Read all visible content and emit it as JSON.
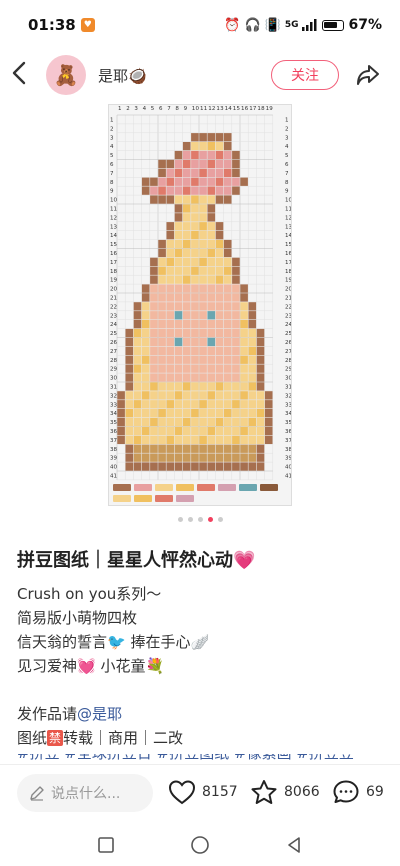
{
  "status_bar": {
    "time": "01:38",
    "signal_label": "5G",
    "battery_pct": "67%"
  },
  "header": {
    "username": "是耶🥥",
    "follow_label": "关注"
  },
  "pattern": {
    "columns": [
      "1",
      "2",
      "3",
      "4",
      "5",
      "6",
      "7",
      "8",
      "9",
      "10",
      "11",
      "12",
      "13",
      "14",
      "15",
      "16",
      "17",
      "18",
      "19"
    ],
    "rows": [
      "1",
      "2",
      "3",
      "4",
      "5",
      "6",
      "7",
      "8",
      "9",
      "10",
      "11",
      "12",
      "13",
      "14",
      "15",
      "16",
      "17",
      "18",
      "19",
      "20",
      "21",
      "22",
      "23",
      "24",
      "25",
      "26",
      "27",
      "28",
      "29",
      "30",
      "31",
      "32",
      "33",
      "34",
      "35",
      "36",
      "37",
      "38",
      "39",
      "40",
      "41"
    ],
    "palette": [
      "#a66f4f",
      "#e8a0a0",
      "#f5d28a",
      "#f0c060",
      "#e07a6a",
      "#d4a0b0",
      "#6aa6b0",
      "#8a5a3a",
      "#f2b8a0",
      "#c99a5a"
    ]
  },
  "carousel": {
    "count": 5,
    "active": 3
  },
  "post": {
    "title": "拼豆图纸｜星星人怦然心动💗",
    "line1": "Crush on you系列～",
    "line2": "简易版小萌物四枚",
    "line3": "信天翁的誓言🐦‍  捧在手心🪽",
    "line4": "见习爱神💓       小花童💐",
    "line5_prefix": "发作品请",
    "line5_link": "@是耶",
    "line6_a": "图纸",
    "line6_forbid": "禁",
    "line6_b": "转载｜商用｜二改",
    "tags": "#拼豆  #全球拼豆日  #拼豆图纸  #像素画  #拼豆豆"
  },
  "bottom": {
    "comment_placeholder": "说点什么...",
    "likes": "8157",
    "collects": "8066",
    "comments": "69"
  }
}
